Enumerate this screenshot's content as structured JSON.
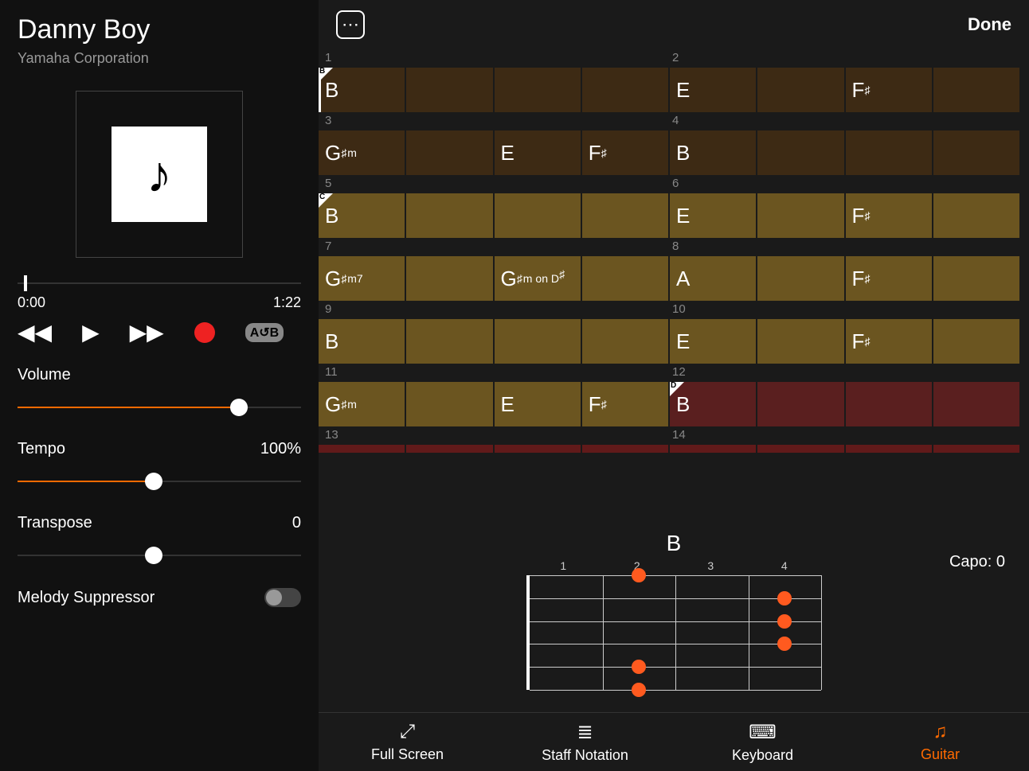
{
  "song": {
    "title": "Danny Boy",
    "artist": "Yamaha Corporation"
  },
  "playback": {
    "current_time": "0:00",
    "total_time": "1:22",
    "ab_loop": "A↺B"
  },
  "controls": {
    "volume": {
      "label": "Volume",
      "percent": 78
    },
    "tempo": {
      "label": "Tempo",
      "value": "100%",
      "percent": 48
    },
    "transpose": {
      "label": "Transpose",
      "value": "0",
      "percent": 48
    },
    "melody_suppressor": {
      "label": "Melody Suppressor",
      "on": false
    }
  },
  "topbar": {
    "done": "Done"
  },
  "chords": {
    "rows": [
      {
        "num_left": "1",
        "num_right": "2",
        "style": "dark",
        "section": "B",
        "playhead": true,
        "cells": [
          "B",
          "",
          "",
          "",
          "E",
          "",
          "F♯",
          ""
        ]
      },
      {
        "num_left": "3",
        "num_right": "4",
        "style": "dark",
        "cells": [
          "G♯m",
          "",
          "E",
          "F♯",
          "B",
          "",
          "",
          ""
        ]
      },
      {
        "num_left": "5",
        "num_right": "6",
        "style": "mid",
        "section": "C",
        "cells": [
          "B",
          "",
          "",
          "",
          "E",
          "",
          "F♯",
          ""
        ]
      },
      {
        "num_left": "7",
        "num_right": "8",
        "style": "mid",
        "cells": [
          "G♯m7",
          "",
          "G♯m on D♯",
          "",
          "A",
          "",
          "F♯",
          ""
        ]
      },
      {
        "num_left": "9",
        "num_right": "10",
        "style": "mid",
        "cells": [
          "B",
          "",
          "",
          "",
          "E",
          "",
          "F♯",
          ""
        ]
      },
      {
        "num_left": "11",
        "num_right": "12",
        "style": "mid",
        "section_right": "D",
        "cells": [
          "G♯m",
          "",
          "E",
          "F♯",
          "B",
          "",
          "",
          ""
        ]
      },
      {
        "num_left": "13",
        "num_right": "14",
        "style": "red2",
        "cells": [
          "",
          "",
          "",
          "",
          "",
          "",
          "",
          ""
        ]
      }
    ]
  },
  "diagram": {
    "chord_name": "B",
    "capo": "Capo: 0",
    "frets": [
      "1",
      "2",
      "3",
      "4"
    ],
    "dots": [
      {
        "fret": 1.5,
        "string": 0
      },
      {
        "fret": 3.5,
        "string": 1
      },
      {
        "fret": 3.5,
        "string": 2
      },
      {
        "fret": 3.5,
        "string": 3
      },
      {
        "fret": 1.5,
        "string": 4
      },
      {
        "fret": 1.5,
        "string": 5
      }
    ]
  },
  "tabs": {
    "items": [
      {
        "label": "Full Screen",
        "icon": "⤢"
      },
      {
        "label": "Staff Notation",
        "icon": "≣"
      },
      {
        "label": "Keyboard",
        "icon": "⌨"
      },
      {
        "label": "Guitar",
        "icon": "♫",
        "active": true
      }
    ]
  }
}
